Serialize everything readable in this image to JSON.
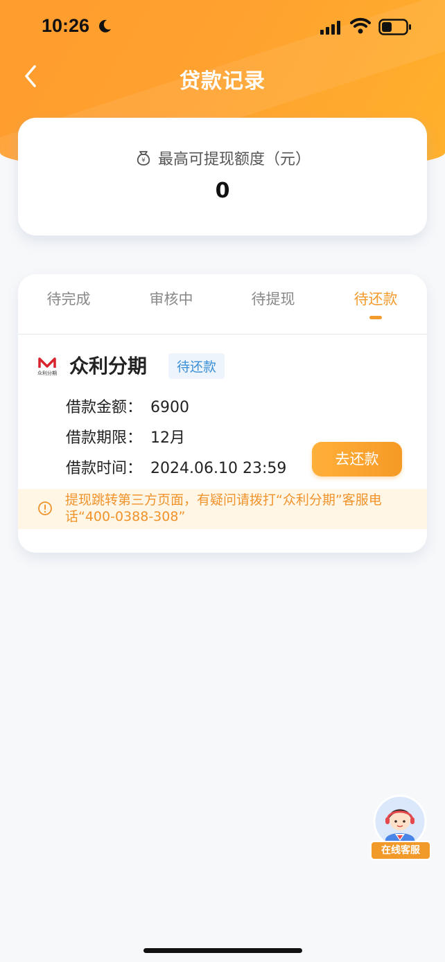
{
  "status_bar": {
    "time": "10:26",
    "icons": [
      "moon-icon",
      "signal-icon",
      "wifi-icon",
      "battery-icon"
    ]
  },
  "nav": {
    "title": "贷款记录",
    "back_icon": "chevron-left-icon"
  },
  "quota": {
    "label": "最高可提现额度（元）",
    "value": "0",
    "icon": "money-bag-icon"
  },
  "tabs": [
    {
      "label": "待完成",
      "active": false
    },
    {
      "label": "审核中",
      "active": false
    },
    {
      "label": "待提现",
      "active": false
    },
    {
      "label": "待还款",
      "active": true
    }
  ],
  "loan": {
    "brand_name": "众利分期",
    "brand_logo_text": "众利分期",
    "status": "待还款",
    "amount_label": "借款金额：",
    "amount_value": "6900",
    "term_label": "借款期限：",
    "term_value": "12月",
    "time_label": "借款时间：",
    "time_value": "2024.06.10 23:59",
    "repay_button": "去还款",
    "notice": "提现跳转第三方页面，有疑问请拨打“众利分期”客服电话“400-0388-308”"
  },
  "support": {
    "label": "在线客服"
  },
  "colors": {
    "accent": "#f39b2c",
    "header_gradient_start": "#ff9d2e",
    "header_gradient_end": "#ffb12c",
    "badge_text": "#3b8fd6",
    "notice_bg": "#fff6e6"
  }
}
